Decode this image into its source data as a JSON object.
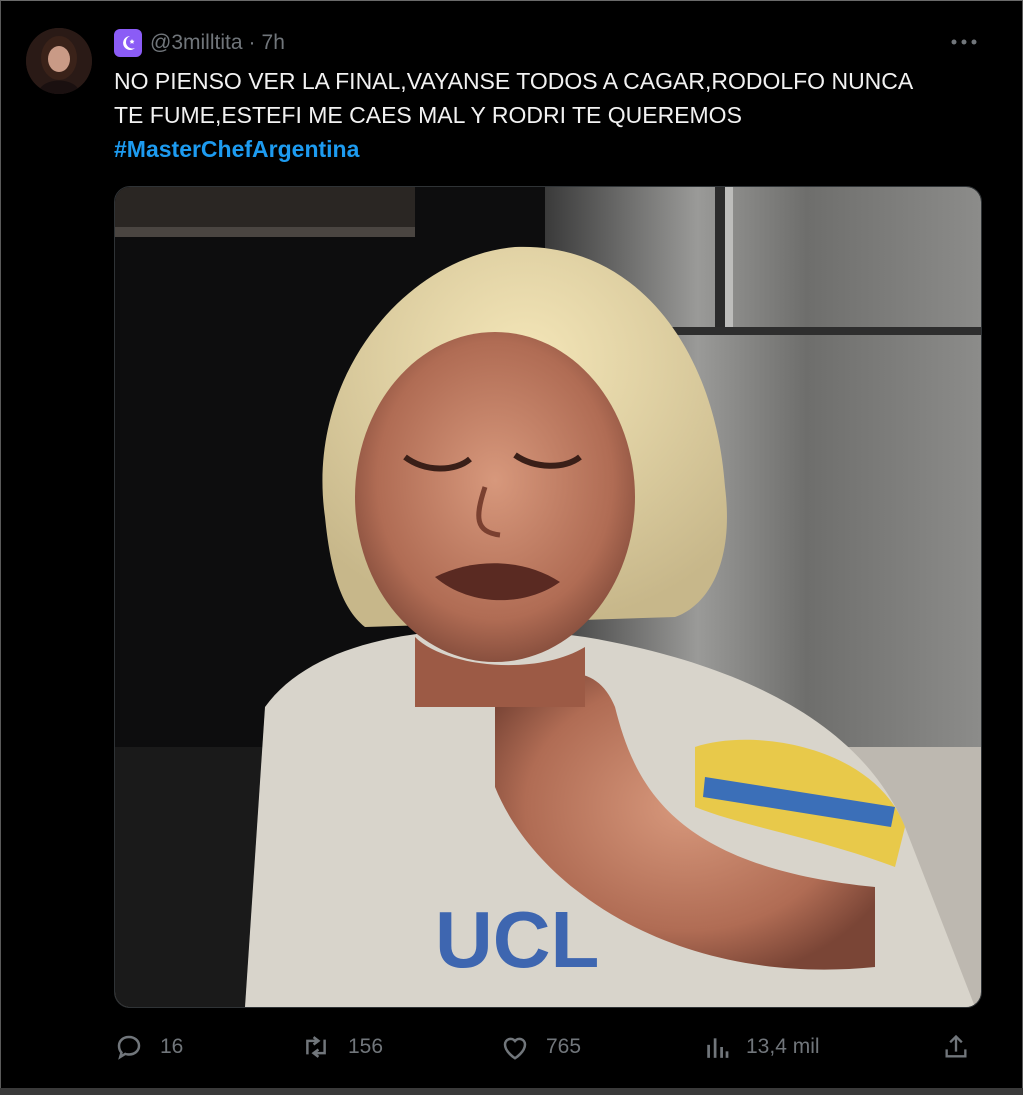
{
  "tweet": {
    "handle": "@3milltita",
    "separator": "·",
    "time": "7h",
    "text_line1": "NO PIENSO VER LA FINAL,VAYANSE TODOS A CAGAR,RODOLFO NUNCA",
    "text_line2": "TE FUME,ESTEFI ME CAES MAL Y RODRI TE QUEREMOS",
    "hashtag": "#MasterChefArgentina"
  },
  "actions": {
    "replies": "16",
    "retweets": "156",
    "likes": "765",
    "views": "13,4 mil"
  },
  "icons": {
    "avatar": "user-avatar",
    "badge": "moon-star-icon",
    "more": "more-horizontal-icon",
    "reply": "reply-icon",
    "retweet": "retweet-icon",
    "like": "heart-icon",
    "views": "views-chart-icon",
    "share": "share-icon"
  },
  "colors": {
    "background": "#000000",
    "text": "#e7e9ea",
    "muted": "#71767b",
    "link": "#1d9bf0",
    "badge": "#8b5cf6"
  }
}
